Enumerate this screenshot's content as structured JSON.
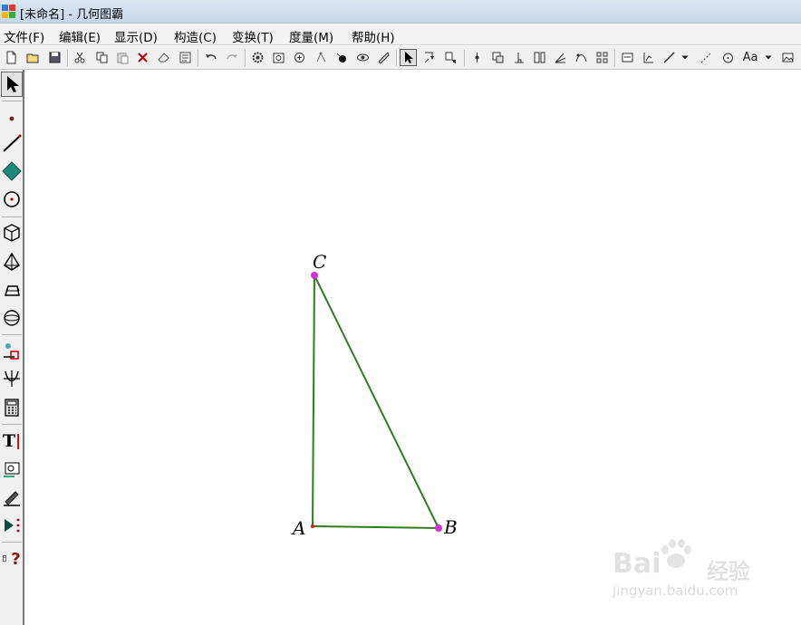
{
  "window": {
    "title": "[未命名] - 几何图霸"
  },
  "menu": {
    "items": [
      {
        "label": "文件(F)"
      },
      {
        "label": "编辑(E)"
      },
      {
        "label": "显示(D)"
      },
      {
        "label": "构造(C)"
      },
      {
        "label": "变换(T)"
      },
      {
        "label": "度量(M)"
      },
      {
        "label": "帮助(H)"
      }
    ]
  },
  "toolbar": {
    "font_button_label": "Aa"
  },
  "palette": {
    "text_tool_label": "T",
    "help_tool_label": "?"
  },
  "sketch": {
    "segment_color": "#2e7d1e",
    "point_color": "#d32fd3",
    "points": [
      {
        "label": "A"
      },
      {
        "label": "B"
      },
      {
        "label": "C"
      }
    ]
  },
  "watermark": {
    "brand_left": "Bai",
    "brand_right": "经验",
    "url": "jingyan.baidu.com"
  }
}
